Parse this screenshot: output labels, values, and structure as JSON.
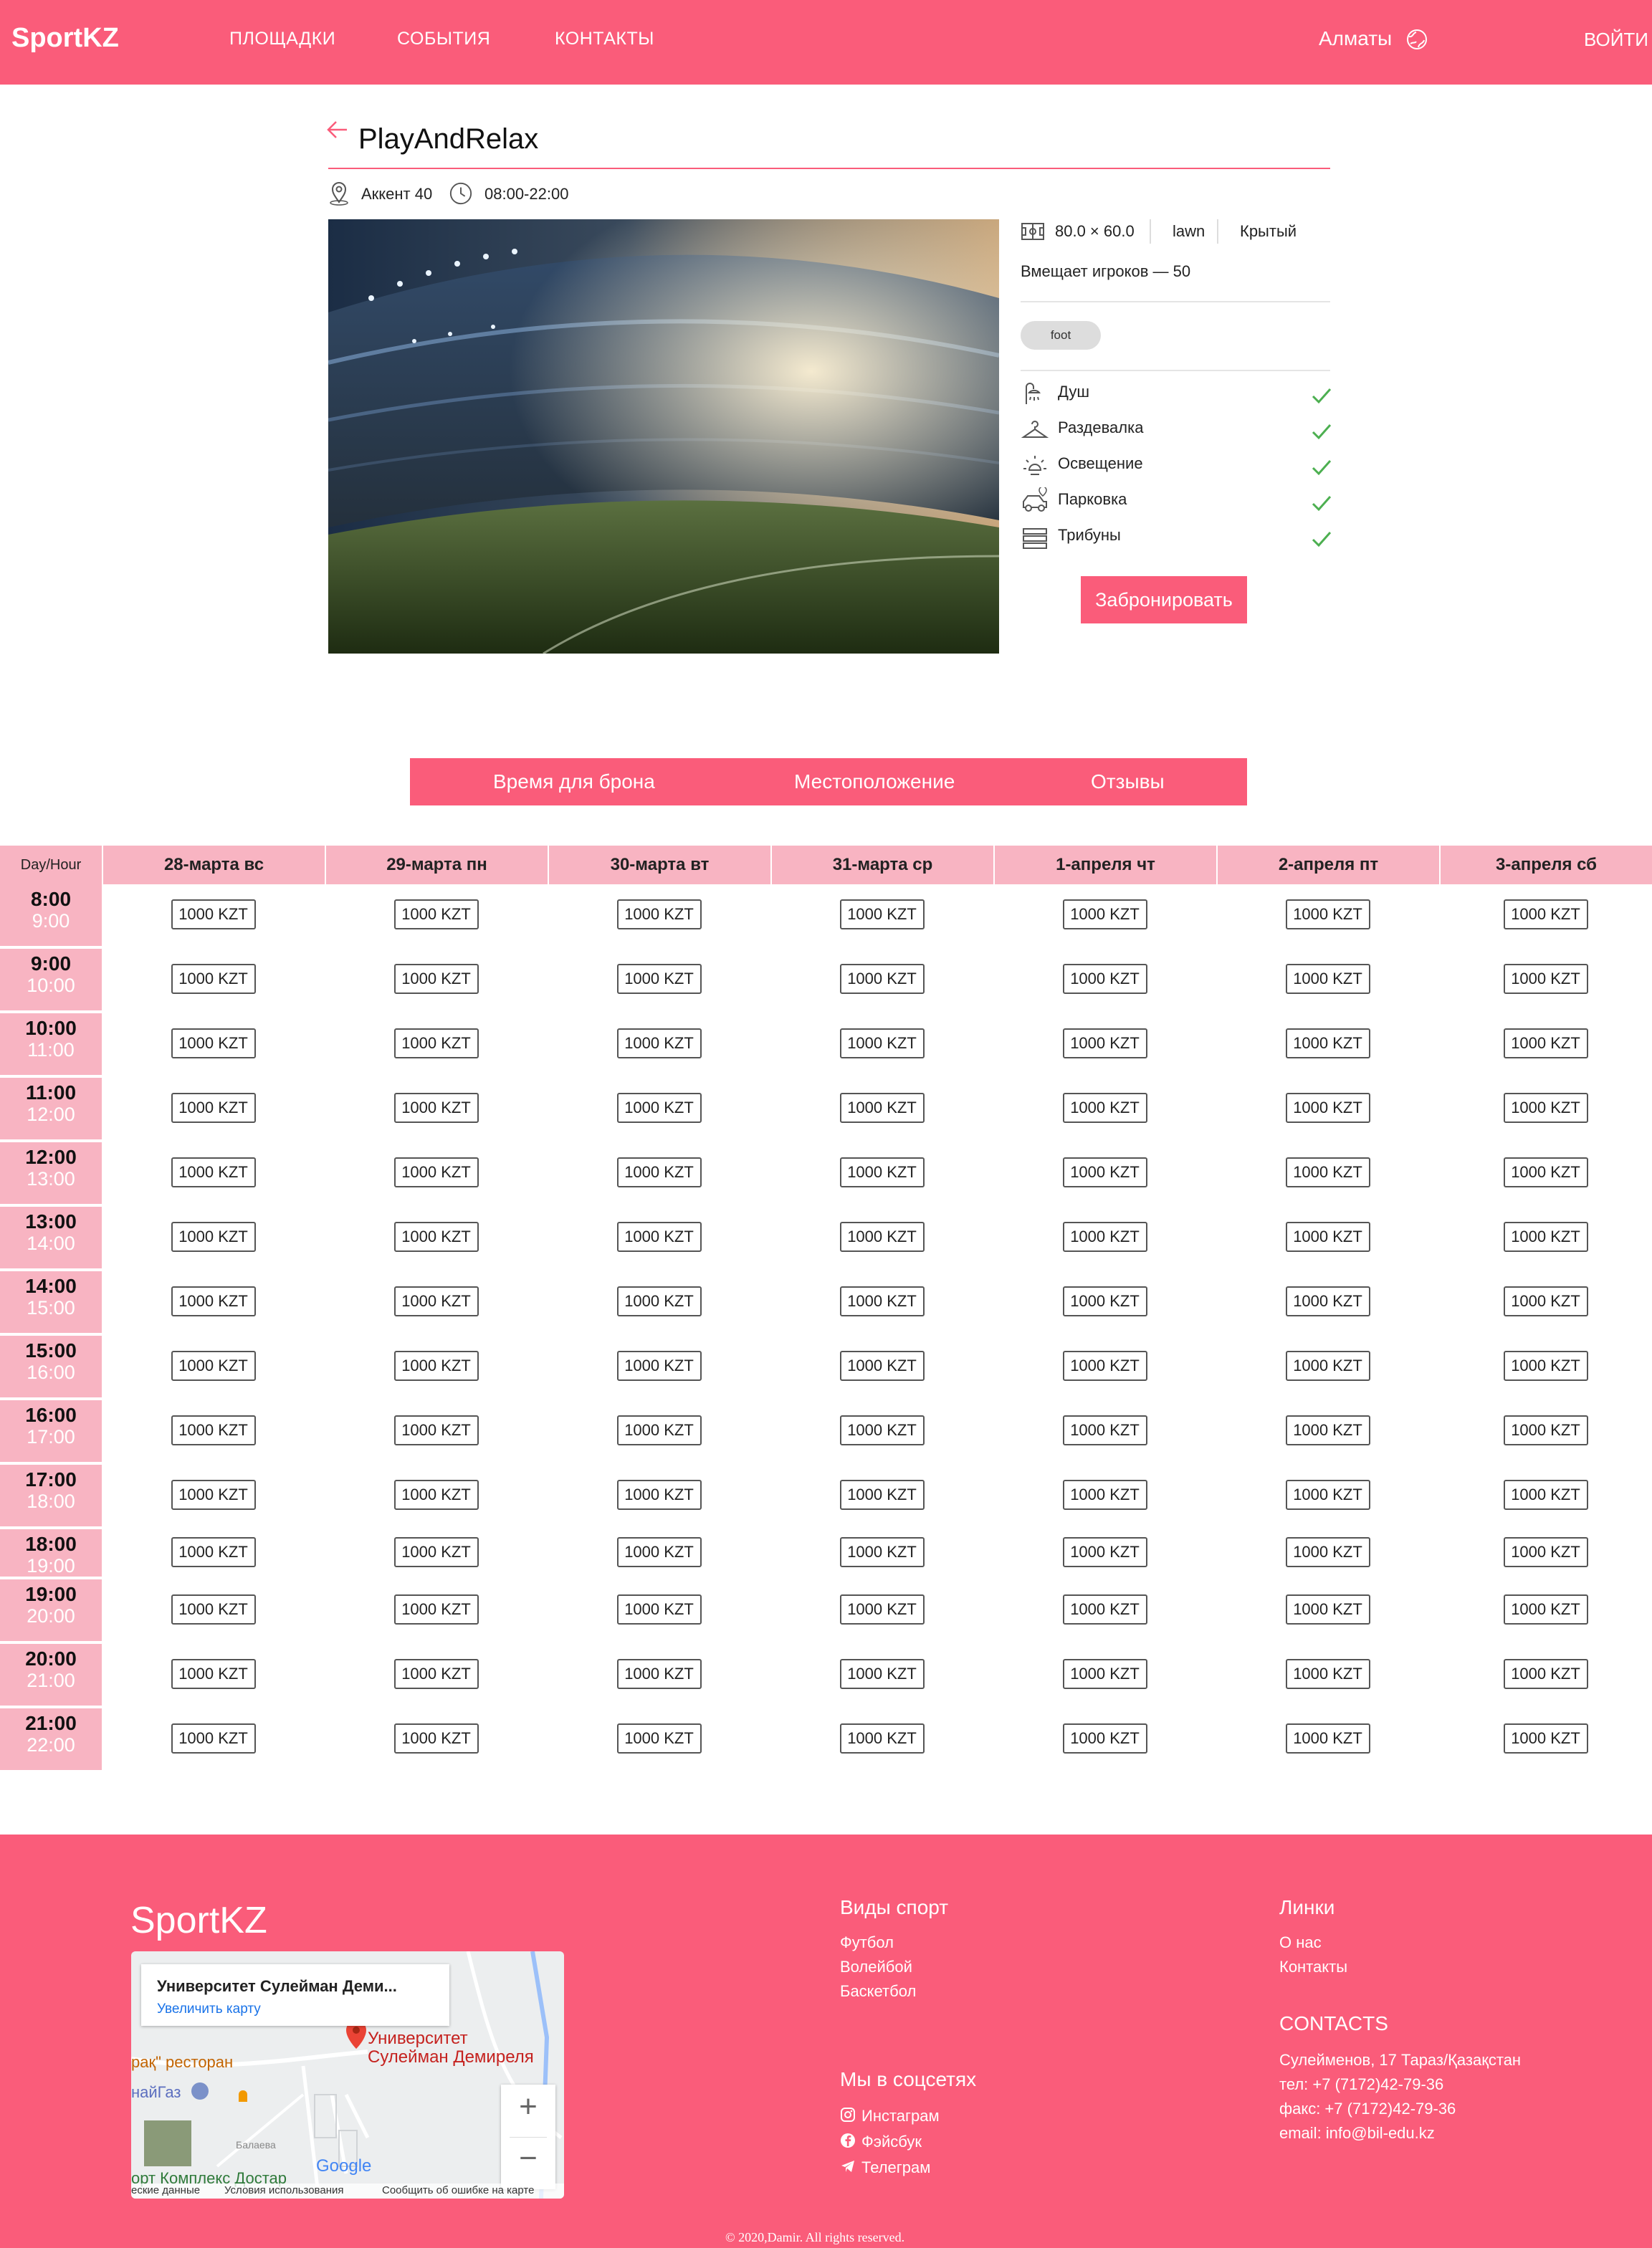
{
  "header": {
    "logo": "SportKZ",
    "nav": [
      "ПЛОЩАДКИ",
      "СОБЫТИЯ",
      "КОНТАКТЫ"
    ],
    "city": "Алматы",
    "login": "ВОЙТИ",
    "icons": {
      "city": "globe-icon"
    },
    "colors": {
      "brand": "#fa5c7a"
    }
  },
  "venue": {
    "name": "PlayAndRelax",
    "address": "Аккент 40",
    "hours": "08:00-22:00",
    "size": "80.0 × 60.0",
    "surface": "lawn",
    "cover": "Крытый",
    "capacity": "Вмещает игроков — 50",
    "tag": "foot",
    "amenities": [
      {
        "label": "Душ",
        "icon": "shower-icon"
      },
      {
        "label": "Раздевалка",
        "icon": "hanger-icon"
      },
      {
        "label": "Освещение",
        "icon": "light-icon"
      },
      {
        "label": "Парковка",
        "icon": "car-icon"
      },
      {
        "label": "Трибуны",
        "icon": "stands-icon"
      }
    ],
    "book_label": "Забронировать"
  },
  "tabs": [
    "Время для брона",
    "Местоположение",
    "Отзывы"
  ],
  "schedule": {
    "corner": "Day/Hour",
    "days": [
      "28-марта вс",
      "29-марта пн",
      "30-марта вт",
      "31-марта ср",
      "1-апреля чт",
      "2-апреля пт",
      "3-апреля сб"
    ],
    "slots": [
      {
        "from": "8:00",
        "to": "9:00"
      },
      {
        "from": "9:00",
        "to": "10:00"
      },
      {
        "from": "10:00",
        "to": "11:00"
      },
      {
        "from": "11:00",
        "to": "12:00"
      },
      {
        "from": "12:00",
        "to": "13:00"
      },
      {
        "from": "13:00",
        "to": "14:00"
      },
      {
        "from": "14:00",
        "to": "15:00"
      },
      {
        "from": "15:00",
        "to": "16:00"
      },
      {
        "from": "16:00",
        "to": "17:00"
      },
      {
        "from": "17:00",
        "to": "18:00"
      },
      {
        "from": "18:00",
        "to": "19:00"
      },
      {
        "from": "19:00",
        "to": "20:00"
      },
      {
        "from": "20:00",
        "to": "21:00"
      },
      {
        "from": "21:00",
        "to": "22:00"
      }
    ],
    "price": "1000 KZT"
  },
  "footer": {
    "logo": "SportKZ",
    "sports_title": "Виды спорт",
    "sports": [
      "Футбол",
      "Волейбой",
      "Баскетбол"
    ],
    "social_title": "Мы в соцсетях",
    "social": [
      "Инстаграм",
      "Фэйсбук",
      "Телеграм"
    ],
    "links_title": "Линки",
    "links": [
      "О нас",
      "Контакты"
    ],
    "contacts_title": "CONTACTS",
    "contacts": [
      "Сулейменов, 17 Тараз/Қазақстан",
      "тел: +7 (7172)42-79-36",
      "факс: +7 (7172)42-79-36",
      "email: info@bil-edu.kz"
    ],
    "copyright": "© 2020,Damir. All rights reserved.",
    "map": {
      "place": "Университет Сулейман Деми...",
      "enlarge": "Увеличить карту",
      "pin_label_1": "Университет",
      "pin_label_2": "Сулейман Демиреля",
      "poi_1": "рақ\" ресторан",
      "poi_2": "найГаз",
      "poi_3": "орт Комплекс Достар",
      "street": "Балаева",
      "brand": "Google",
      "terms": [
        "еские данные",
        "Условия использования",
        "Сообщить об ошибке на карте"
      ]
    }
  }
}
